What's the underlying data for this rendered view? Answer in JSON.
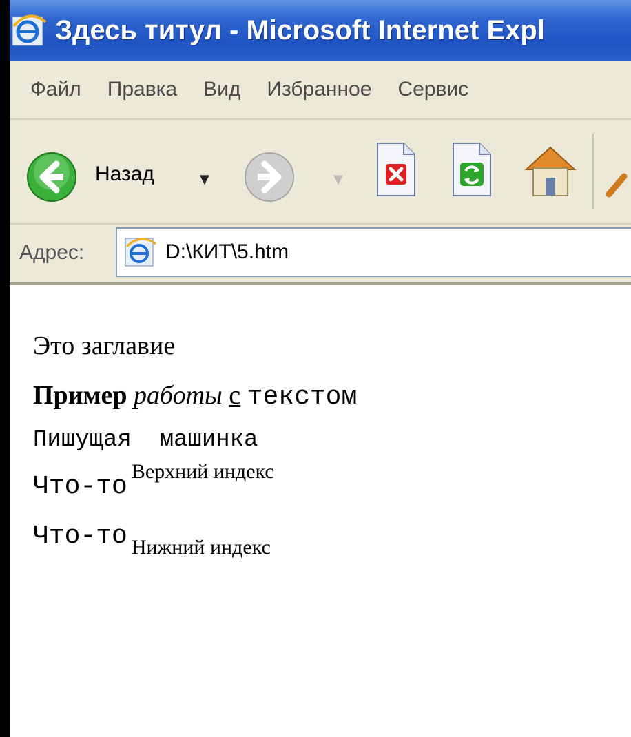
{
  "window": {
    "title": "Здесь титул - Microsoft Internet Expl"
  },
  "menu": {
    "items": [
      "Файл",
      "Правка",
      "Вид",
      "Избранное",
      "Сервис"
    ]
  },
  "toolbar": {
    "back_label": "Назад",
    "icons": [
      "back-icon",
      "forward-icon",
      "stop-icon",
      "refresh-icon",
      "home-icon",
      "search-icon"
    ]
  },
  "address": {
    "label": "Адрес:",
    "value": "D:\\КИТ\\5.htm"
  },
  "content": {
    "heading": "Это заглавие",
    "line2": {
      "bold": "Пример",
      "italic": "работы",
      "underline": "с",
      "mono": "текстом"
    },
    "typewriter": "Пишущая  машинка",
    "sup_line": {
      "base": "Что-то",
      "sup": "Верхний индекс"
    },
    "sub_line": {
      "base": "Что-то",
      "sub": "Нижний индекс"
    }
  },
  "colors": {
    "titlebar": "#2f66d0",
    "chrome": "#ece9d8",
    "background_outer": "#000000"
  }
}
